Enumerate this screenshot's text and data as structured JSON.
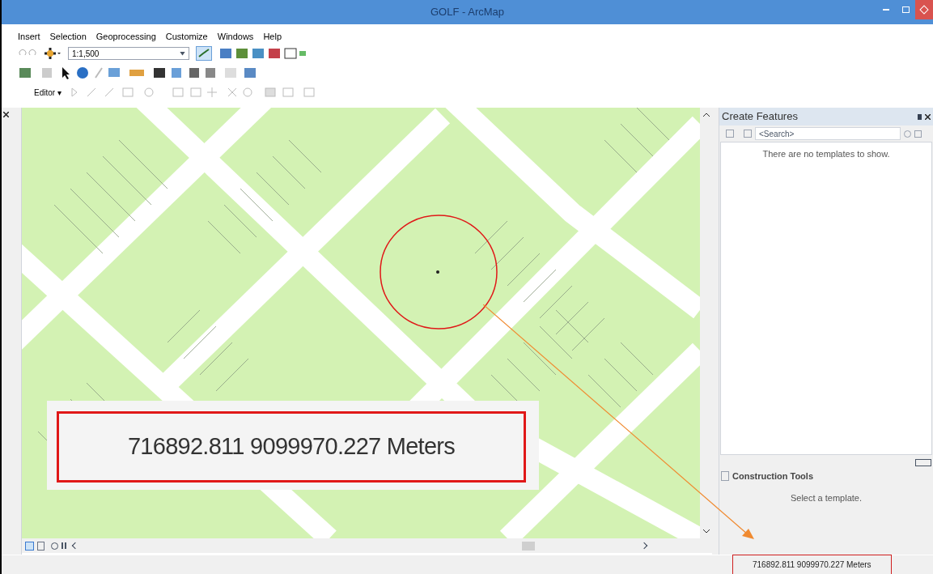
{
  "window": {
    "title": "GOLF - ArcMap"
  },
  "menu": [
    "Insert",
    "Selection",
    "Geoprocessing",
    "Customize",
    "Windows",
    "Help"
  ],
  "toolbar": {
    "scale": "1:1,500",
    "editor": "Editor ▾"
  },
  "create_features": {
    "title": "Create Features",
    "search": {
      "placeholder": "<Search>"
    },
    "message": "There are no templates to show."
  },
  "construction_tools": {
    "title": "Construction Tools",
    "message": "Select a template."
  },
  "status_bar": {
    "coordinates": "716892.811  9099970.227 Meters"
  },
  "inset": {
    "coordinates": "716892.811  9099970.227 Meters"
  }
}
